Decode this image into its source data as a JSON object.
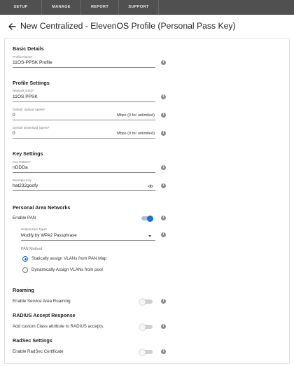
{
  "nav": {
    "tabs": [
      "SETUP",
      "MANAGE",
      "REPORT",
      "SUPPORT"
    ]
  },
  "header": {
    "title": "New Centralized - ElevenOS Profile (Personal Pass Key)"
  },
  "basic": {
    "title": "Basic Details",
    "profile_name": {
      "label": "Profile Name*",
      "value": "11OS-PPSK Profile"
    }
  },
  "profile": {
    "title": "Profile Settings",
    "ssid": {
      "label": "Network SSID*",
      "value": "11OS PPSK"
    },
    "upload": {
      "label": "Default Upload Speed*",
      "value": "0",
      "suffix": "Mbps (0 for unlimited)"
    },
    "download": {
      "label": "Default Download Speed*",
      "value": "0",
      "suffix": "Mbps (0 for unlimited)"
    }
  },
  "keys": {
    "title": "Key Settings",
    "pattern": {
      "label": "Key Pattern*",
      "value": "nDDDa"
    },
    "example": {
      "label": "Example Key",
      "value": "hat232goofy"
    }
  },
  "pan": {
    "title": "Personal Area Networks",
    "enable_label": "Enable PAN",
    "enabled": true,
    "suspension": {
      "label": "Suspension Type*",
      "value": "Modify by WPA2 Passphrase"
    },
    "method_label": "PAN Method",
    "options": [
      "Statically assign VLANs from PAN Map",
      "Dynamically Assign VLANs from pool"
    ],
    "selected_option": 0
  },
  "roaming": {
    "title": "Roaming",
    "label": "Enable Service Area Roaming",
    "enabled": false
  },
  "radius": {
    "title": "RADIUS Accept Response",
    "label": "Add custom Class attribute to RADIUS accepts.",
    "enabled": false
  },
  "radsec": {
    "title": "RadSec Settings",
    "label": "Enable RadSec Certificate",
    "enabled": false
  },
  "colors": {
    "nav_bg": "#505050",
    "accent": "#1f6fd0",
    "toggle_on_track": "#9cc0ec",
    "toggle_off_track": "#cfcfcf",
    "toggle_off_knob": "#f5f5f5",
    "info_icon": "#8c8c8c"
  },
  "icons": {
    "back": "arrow-left-icon",
    "info": "info-icon",
    "visibility": "eye-icon",
    "dropdown": "caret-down-icon"
  }
}
